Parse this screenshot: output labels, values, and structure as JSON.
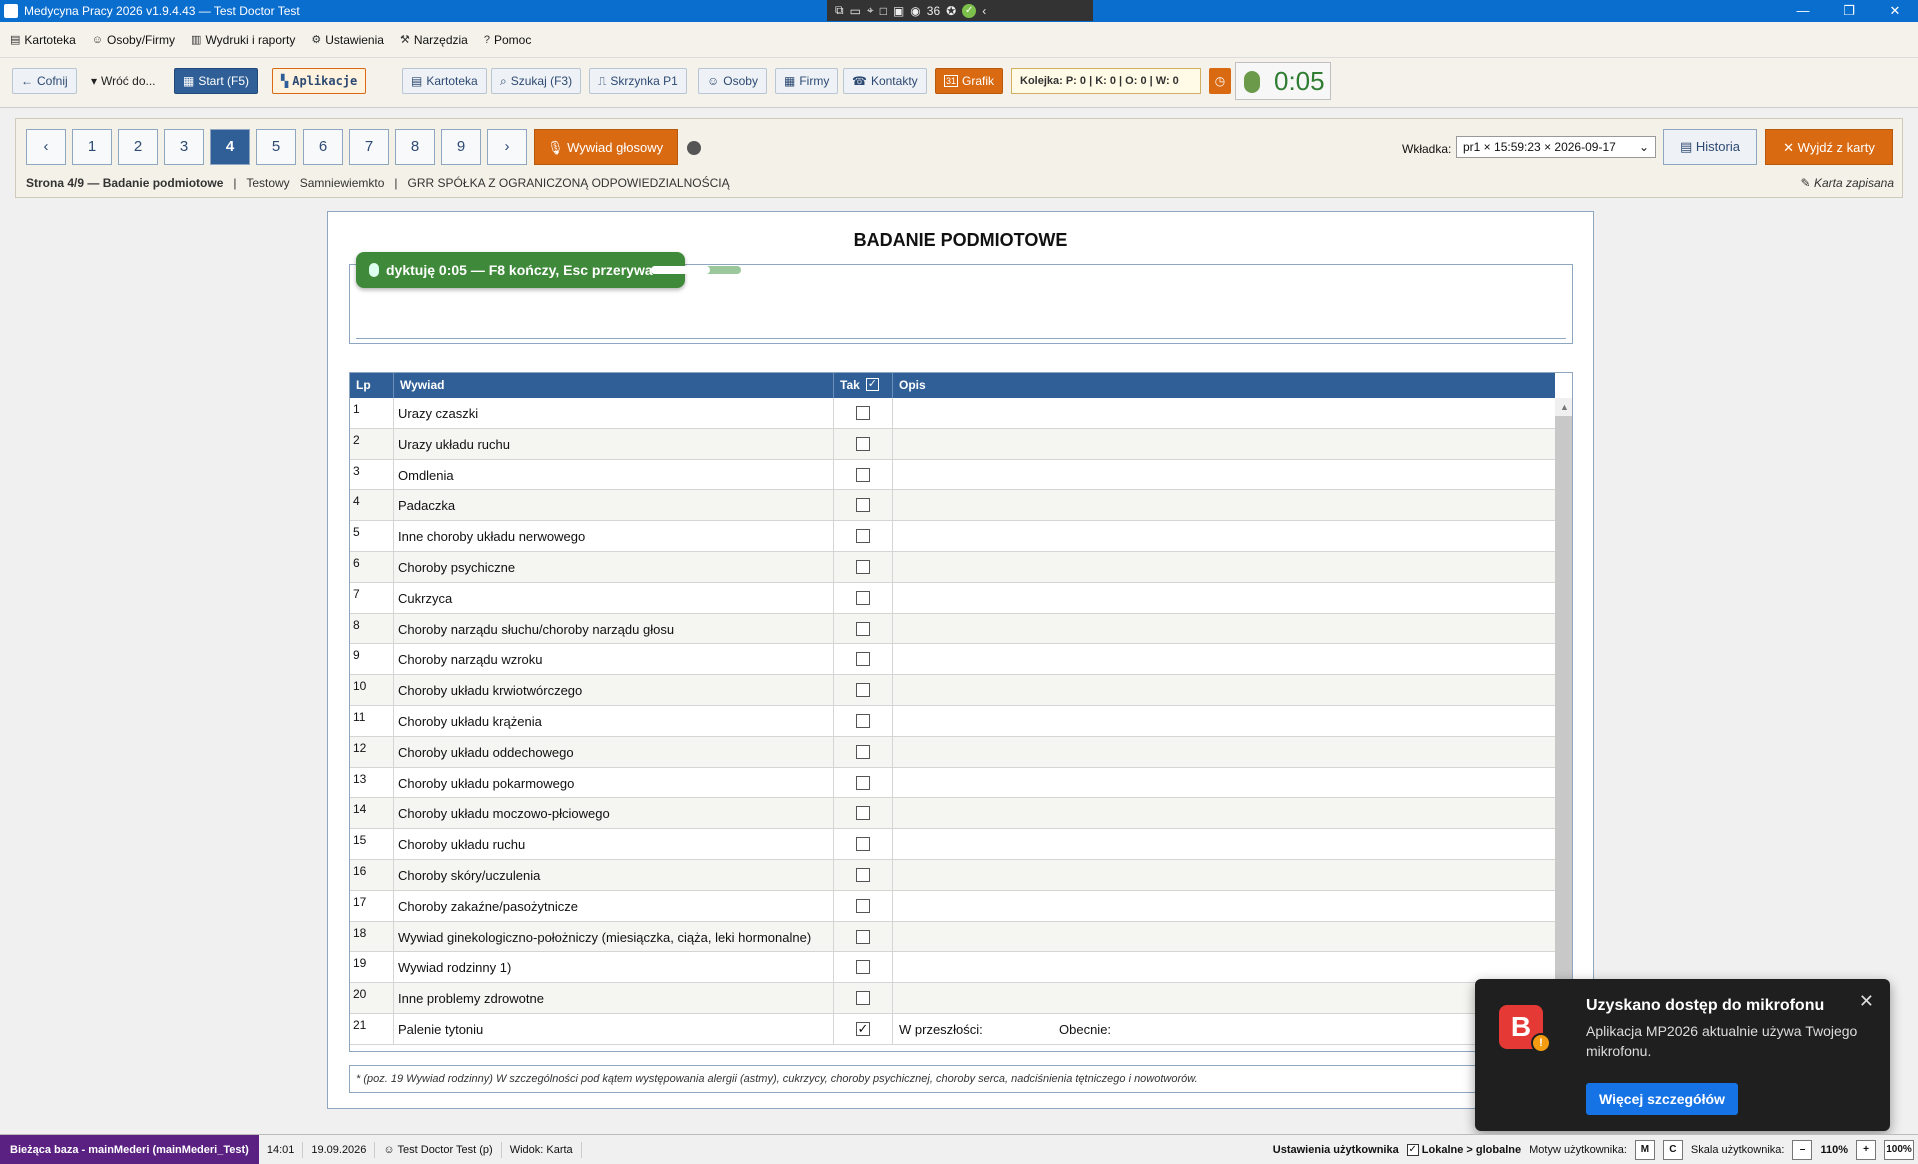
{
  "window": {
    "title": "Medycyna Pracy 2026 v1.9.4.43 — Test Doctor Test",
    "tray_count": "36",
    "minimize": "—",
    "maximize": "❐",
    "close": "✕"
  },
  "menu": [
    {
      "label": "Kartoteka",
      "icon": "cards-icon"
    },
    {
      "label": "Osoby/Firmy",
      "icon": "people-icon"
    },
    {
      "label": "Wydruki i raporty",
      "icon": "print-icon"
    },
    {
      "label": "Ustawienia",
      "icon": "gear-icon"
    },
    {
      "label": "Narzędzia",
      "icon": "tools-icon"
    },
    {
      "label": "Pomoc",
      "icon": "help-icon"
    }
  ],
  "toolbar": {
    "back": "Cofnij",
    "return_to": "Wróć do...",
    "start": "Start (F5)",
    "apps": "Aplikacje",
    "kartoteka": "Kartoteka",
    "search": "Szukaj (F3)",
    "inbox": "Skrzynka P1",
    "persons": "Osoby",
    "companies": "Firmy",
    "contacts": "Kontakty",
    "schedule": "Grafik",
    "schedule_badge": "31",
    "queue": "Kolejka: P: 0 | K: 0 | O: 0 | W: 0",
    "timer": "0:05"
  },
  "pager": {
    "prev": "‹",
    "next": "›",
    "pages": [
      "1",
      "2",
      "3",
      "4",
      "5",
      "6",
      "7",
      "8",
      "9"
    ],
    "active": "4",
    "voice_button": "Wywiad głosowy"
  },
  "breadcrumb": {
    "page": "Strona 4/9 — Badanie podmiotowe",
    "sep1": "|",
    "patient_first": "Testowy",
    "patient_last": "Samniewiemkto",
    "sep2": "|",
    "company": "GRR SPÓŁKA Z OGRANICZONĄ ODPOWIEDZIALNOŚCIĄ"
  },
  "tab_select": {
    "label": "Wkładka:",
    "value": "pr1 × 15:59:23 × 2026-09-17"
  },
  "history": "Historia",
  "exit": "Wyjdź z karty",
  "saved_status": "Karta zapisana",
  "form": {
    "title": "BADANIE PODMIOTOWE",
    "dictation": "dyktuję 0:05 — F8 kończy, Esc przerywa",
    "dictation_progress": 0.65,
    "columns": {
      "lp": "Lp",
      "wywiad": "Wywiad",
      "tak": "Tak",
      "opis": "Opis"
    },
    "rows": [
      {
        "lp": "1",
        "label": "Urazy czaszki",
        "checked": false
      },
      {
        "lp": "2",
        "label": "Urazy układu ruchu",
        "checked": false
      },
      {
        "lp": "3",
        "label": "Omdlenia",
        "checked": false
      },
      {
        "lp": "4",
        "label": "Padaczka",
        "checked": false
      },
      {
        "lp": "5",
        "label": "Inne choroby układu nerwowego",
        "checked": false
      },
      {
        "lp": "6",
        "label": "Choroby psychiczne",
        "checked": false
      },
      {
        "lp": "7",
        "label": "Cukrzyca",
        "checked": false
      },
      {
        "lp": "8",
        "label": "Choroby narządu słuchu/choroby narządu głosu",
        "checked": false
      },
      {
        "lp": "9",
        "label": "Choroby narządu wzroku",
        "checked": false
      },
      {
        "lp": "10",
        "label": "Choroby układu krwiotwórczego",
        "checked": false
      },
      {
        "lp": "11",
        "label": "Choroby układu krążenia",
        "checked": false
      },
      {
        "lp": "12",
        "label": "Choroby układu oddechowego",
        "checked": false
      },
      {
        "lp": "13",
        "label": "Choroby układu pokarmowego",
        "checked": false
      },
      {
        "lp": "14",
        "label": "Choroby układu moczowo-płciowego",
        "checked": false
      },
      {
        "lp": "15",
        "label": "Choroby układu ruchu",
        "checked": false
      },
      {
        "lp": "16",
        "label": "Choroby skóry/uczulenia",
        "checked": false
      },
      {
        "lp": "17",
        "label": "Choroby zakaźne/pasożytnicze",
        "checked": false
      },
      {
        "lp": "18",
        "label": "Wywiad ginekologiczno-położniczy (miesiączka, ciąża, leki hormonalne)",
        "checked": false
      },
      {
        "lp": "19",
        "label": "Wywiad rodzinny 1)",
        "checked": false
      },
      {
        "lp": "20",
        "label": "Inne problemy zdrowotne",
        "checked": false
      },
      {
        "lp": "21",
        "label": "Palenie tytoniu",
        "checked": true,
        "opis_past": "W przeszłości:",
        "opis_now": "Obecnie:"
      }
    ],
    "footnote": "* (poz. 19 Wywiad rodzinny) W szczególności pod kątem występowania alergii (astmy), cukrzycy, choroby psychicznej, choroby serca, nadciśnienia tętniczego i nowotworów."
  },
  "toast": {
    "logo": "B",
    "badge": "!",
    "title": "Uzyskano dostęp do mikrofonu",
    "text": "Aplikacja MP2026 aktualnie używa Twojego mikrofonu.",
    "button": "Więcej szczegółów",
    "close": "✕"
  },
  "statusbar": {
    "database": "Bieżąca baza - mainMederi (mainMederi_Test)",
    "time": "14:01",
    "date": "19.09.2026",
    "user": "Test Doctor Test (p)",
    "view": "Widok: Karta",
    "user_settings": "Ustawienia użytkownika",
    "local_global": "Lokalne > globalne",
    "theme_label": "Motyw użytkownika:",
    "theme_m": "M",
    "theme_c": "C",
    "scale_label": "Skala użytkownika:",
    "scale_minus": "–",
    "scale_value": "110%",
    "scale_plus": "+",
    "scale_reset": "100%"
  },
  "colors": {
    "accent": "#2f5f96",
    "orange": "#d96a12",
    "title_bar": "#0a6ecf",
    "dictation": "#3f8a3a",
    "status_db": "#5a2082"
  }
}
